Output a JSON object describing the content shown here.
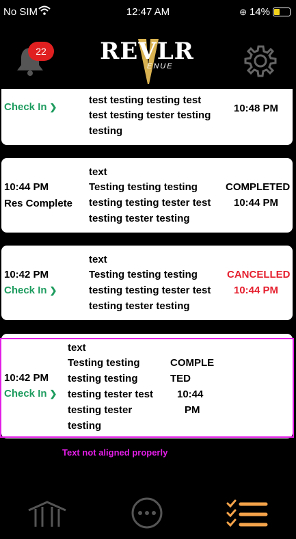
{
  "status": {
    "carrier": "No SIM",
    "time": "12:47 AM",
    "battery": "14%"
  },
  "header": {
    "badge_count": "22",
    "logo_main": "REVLR",
    "logo_sub": "ENUE"
  },
  "cards": [
    {
      "time": "",
      "action": "Check In",
      "desc_lines": [
        "test testing testing test",
        "test testing tester testing",
        "testing"
      ],
      "status": "",
      "status_time": "10:48 PM"
    },
    {
      "time": "10:44 PM",
      "action": "Res Complete",
      "desc_lines": [
        "text",
        "Testing testing testing",
        "testing testing tester test",
        "testing tester testing"
      ],
      "status": "COMPLETED",
      "status_time": "10:44 PM"
    },
    {
      "time": "10:42 PM",
      "action": "Check In",
      "desc_lines": [
        "text",
        "Testing testing testing",
        "testing testing tester test",
        "testing tester testing"
      ],
      "status": "CANCELLED",
      "status_time": "10:44 PM"
    },
    {
      "time": "10:42 PM",
      "action": "Check In",
      "desc_lines": [
        "text",
        "Testing testing",
        "testing testing",
        "testing tester test",
        "testing tester",
        "testing"
      ],
      "status_lines": [
        "COMPLE",
        "TED",
        "10:44",
        "PM"
      ]
    }
  ],
  "annotation": "Text not aligned properly",
  "colors": {
    "green": "#1e9c5f",
    "red": "#e5202f",
    "magenta": "#e21ee6",
    "orange": "#f5a34a"
  },
  "tabs": [
    {
      "icon": "venue-icon"
    },
    {
      "icon": "more-icon"
    },
    {
      "icon": "checklist-icon"
    }
  ]
}
